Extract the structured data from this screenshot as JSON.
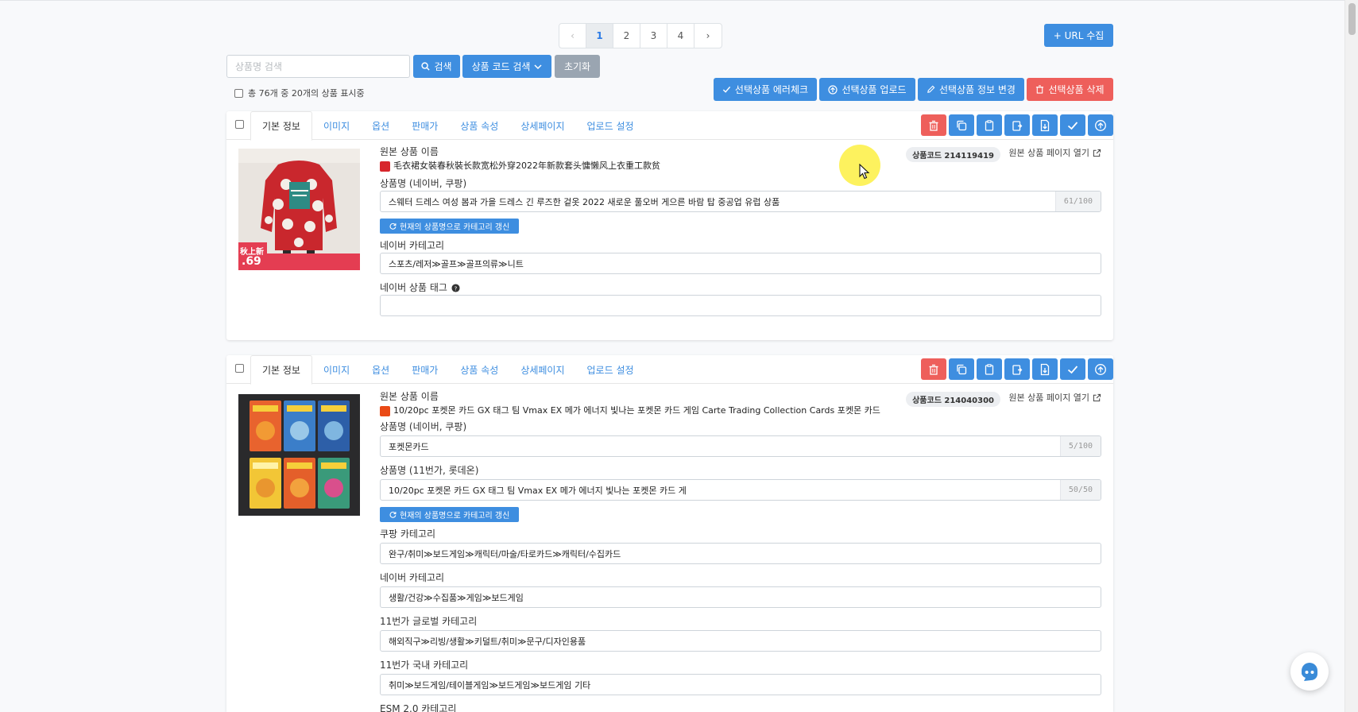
{
  "pagination": {
    "prev": "‹",
    "pages": [
      "1",
      "2",
      "3",
      "4"
    ],
    "active": "1",
    "next": "›"
  },
  "header": {
    "url_collect_label": "+ URL 수집"
  },
  "search": {
    "placeholder": "상품명 검색",
    "search_label": "검색",
    "code_search_label": "상품 코드 검색",
    "reset_label": "초기화"
  },
  "count_text": "총 76개 중 20개의 상품 표시중",
  "bulk_actions": {
    "error_check": "선택상품 에러체크",
    "upload": "선택상품 업로드",
    "edit_info": "선택상품 정보 변경",
    "delete": "선택상품 삭제"
  },
  "tabs": [
    "기본 정보",
    "이미지",
    "옵션",
    "판매가",
    "상품 속성",
    "상세페이지",
    "업로드 설정"
  ],
  "labels": {
    "original_name": "원본 상품 이름",
    "name_naver_coupang": "상품명 (네이버, 쿠팡)",
    "name_11st_lotte": "상품명 (11번가, 롯데온)",
    "refresh_category": "현재의 상품명으로 카테고리 갱신",
    "naver_category": "네이버 카테고리",
    "naver_tags": "네이버 상품 태그",
    "coupang_category": "쿠팡 카테고리",
    "global_11st_category": "11번가 글로벌 카테고리",
    "domestic_11st_category": "11번가 국내 카테고리",
    "esm_category": "ESM 2.0 카테고리",
    "open_original": "원본 상품 페이지 열기"
  },
  "products": [
    {
      "code": "상품코드 214119419",
      "original_title": "毛衣裙女裝春秋裝长款宽松外穿2022年新款套头慵懒风上衣重工款贫",
      "name": "스웨터 드레스 여성 봄과 가을 드레스 긴 루즈한 겉옷 2022 새로운 풀오버 게으른 바람 탑 중공업 유럽 상품",
      "name_count": "61/100",
      "naver_category": "스포츠/레저≫골프≫골프의류≫니트",
      "naver_tags": "",
      "image_text_1": "秋上新",
      "image_text_2": ".69"
    },
    {
      "code": "상품코드 214040300",
      "original_title": "10/20pc 포켓몬 카드 GX 태그 팀 Vmax EX 메가 에너지 빛나는 포켓몬 카드 게임 Carte Trading Collection Cards 포켓몬 카드",
      "name": "포켓몬카드",
      "name_count": "5/100",
      "name_11st": "10/20pc 포켓몬 카드 GX 태그 팀 Vmax EX 메가 에너지 빛나는 포켓몬 카드 게",
      "name_11st_count": "50/50",
      "coupang_category": "완구/취미≫보드게임≫캐릭터/마술/타로카드≫캐릭터/수집카드",
      "naver_category": "생활/건강≫수집품≫게임≫보드게임",
      "global_11st_category": "해외직구≫리빙/생활≫키덜트/취미≫문구/디자인용품",
      "domestic_11st_category": "취미≫보드게임/테이블게임≫보드게임≫보드게임 기타"
    }
  ],
  "colors": {
    "primary": "#3e8ee0",
    "danger": "#ee5f5b",
    "muted": "#9aa5b1"
  }
}
